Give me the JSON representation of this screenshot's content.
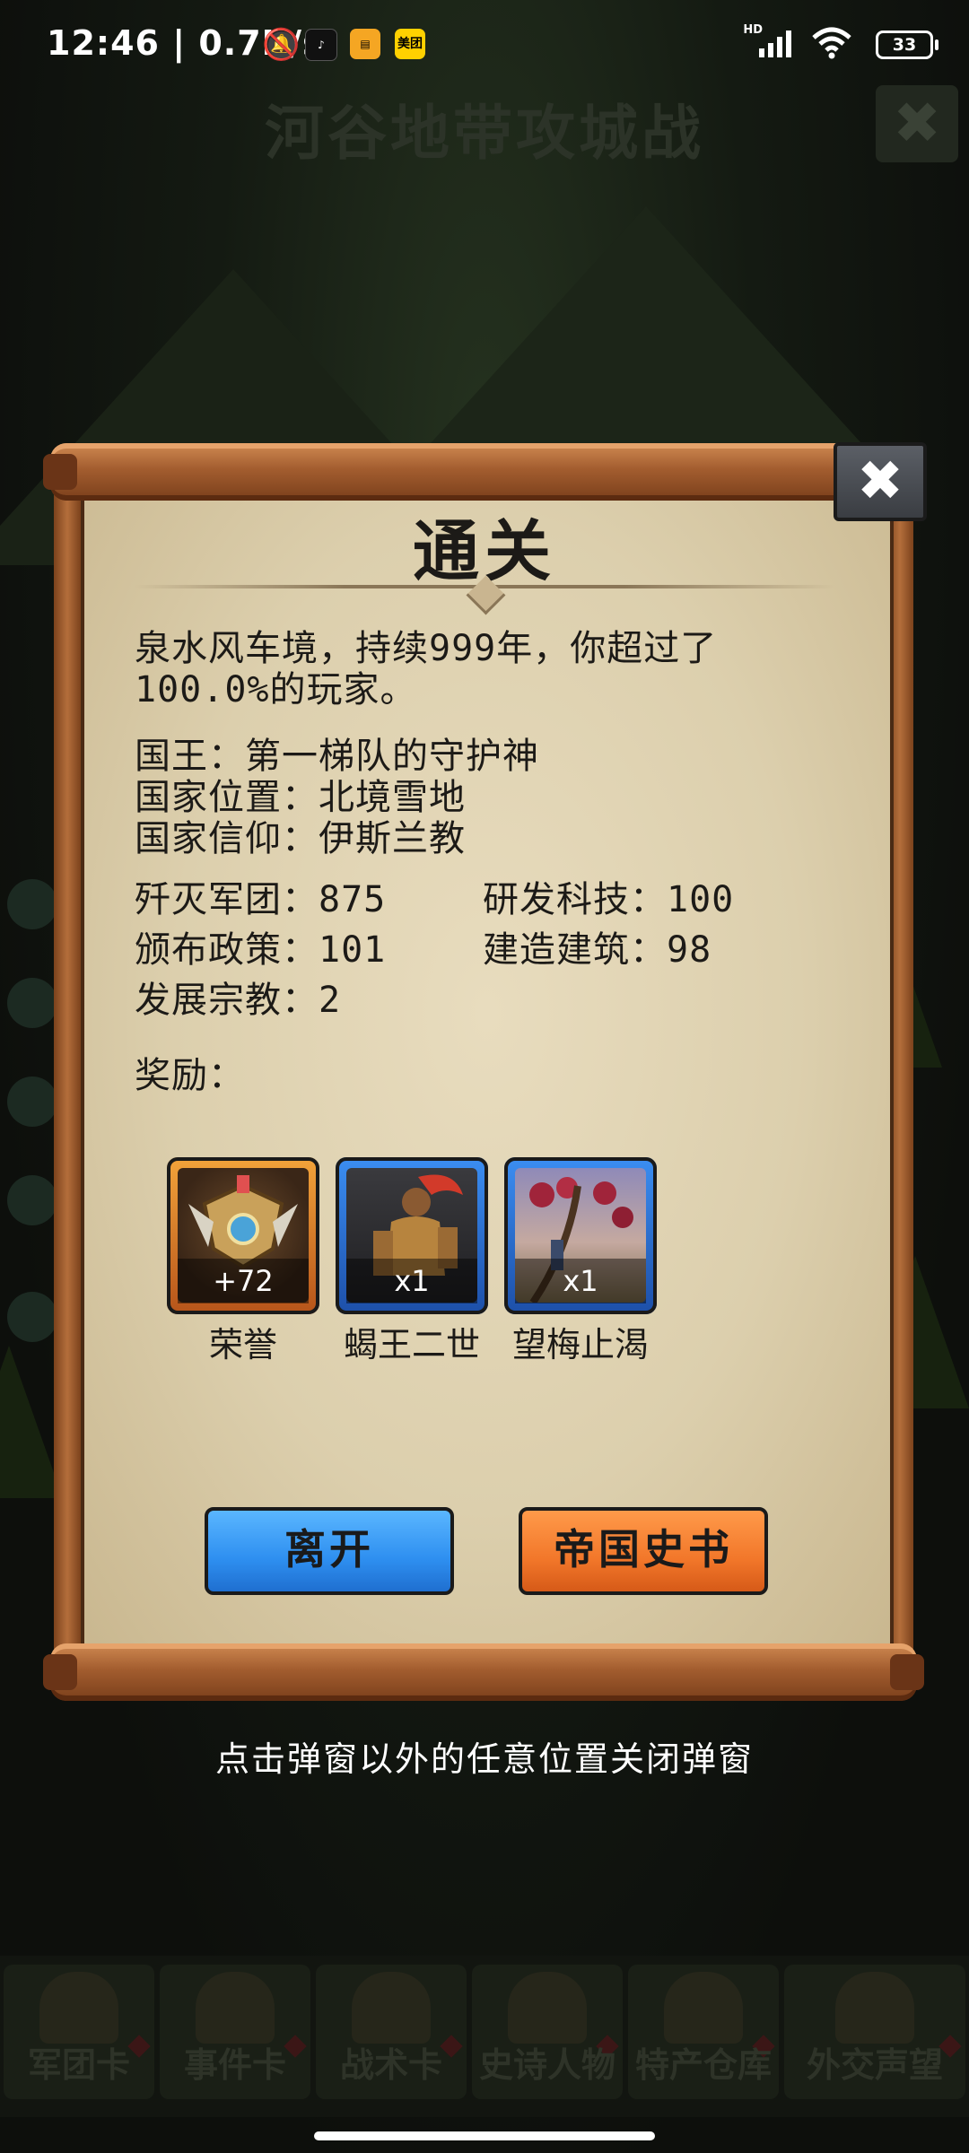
{
  "status_bar": {
    "time": "12:46",
    "net_speed": "0.7K/s",
    "app_icon_meituan": "美团",
    "signal_label": "HD",
    "battery": "33"
  },
  "background": {
    "screen_title": "河谷地带攻城战",
    "tabs": [
      "军团卡",
      "事件卡",
      "战术卡",
      "史诗人物",
      "特产仓库",
      "外交声望"
    ]
  },
  "dialog": {
    "title": "通关",
    "summary": "泉水风车境，持续999年，你超过了100.0%的玩家。",
    "king": "国王：第一梯队的守护神",
    "location": "国家位置：北境雪地",
    "religion": "国家信仰：伊斯兰教",
    "stats": {
      "destroyed": "歼灭军团：875",
      "research": "研发科技：100",
      "policies": "颁布政策：101",
      "buildings": "建造建筑：98",
      "religion_dev": "发展宗教：2"
    },
    "rewards_label": "奖励：",
    "rewards": [
      {
        "name": "荣誉",
        "qty": "+72",
        "icon": "honor-medal-icon"
      },
      {
        "name": "蝎王二世",
        "qty": "x1",
        "icon": "scorpion-king-icon"
      },
      {
        "name": "望梅止渴",
        "qty": "x1",
        "icon": "plum-tree-icon"
      }
    ],
    "leave_button": "离开",
    "history_button": "帝国史书",
    "dismiss_hint": "点击弹窗以外的任意位置关闭弹窗"
  },
  "colors": {
    "paper": "#dccfad",
    "wood": "#a35d2f",
    "blue_button": "#2e8ff0",
    "orange_button": "#f2772a"
  }
}
